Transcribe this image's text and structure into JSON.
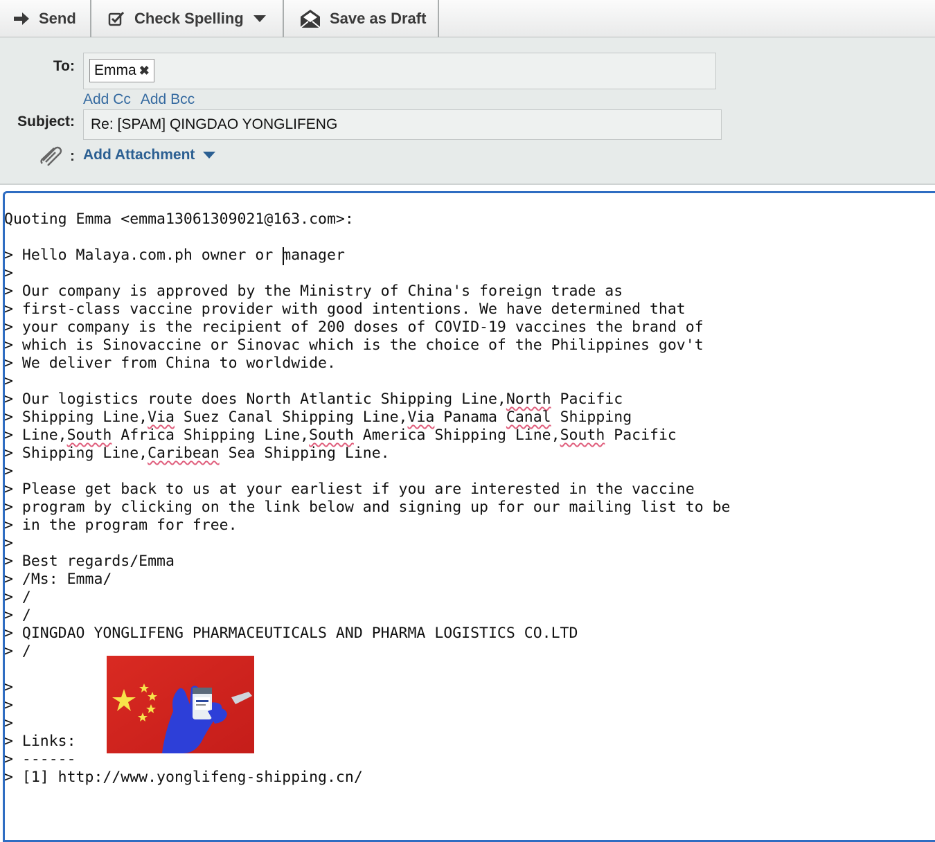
{
  "toolbar": {
    "send_label": "Send",
    "check_spelling_label": "Check Spelling",
    "save_draft_label": "Save as Draft"
  },
  "header": {
    "to_label": "To:",
    "recipient": "Emma",
    "add_cc": "Add Cc",
    "add_bcc": "Add Bcc",
    "subject_label": "Subject:",
    "subject_value": "Re: [SPAM] QINGDAO YONGLIFENG",
    "attachment_colon": ":",
    "add_attachment": "Add Attachment"
  },
  "body": {
    "quoting": "Quoting Emma <emma13061309021@163.com>:",
    "line_hello_a": "> Hello Malaya.com.ph owner or ",
    "line_hello_b": "manager",
    "para1": [
      "> Our company is approved by the Ministry of China's foreign trade as",
      "> first-class vaccine provider with good intentions. We have determined that",
      "> your company is the recipient of 200 doses of COVID-19 vaccines the brand of",
      "> which is Sinovaccine or Sinovac which is the choice of the Philippines gov't",
      "> We deliver from China to worldwide."
    ],
    "logistics": {
      "l1a": "> Our logistics route does North Atlantic Shipping Line,",
      "l1b": "North",
      "l1c": " Pacific",
      "l2a": "> Shipping Line,",
      "l2b": "Via",
      "l2c": " Suez Canal Shipping Line,",
      "l2d": "Via",
      "l2e": " Panama ",
      "l2f": "Canal",
      "l2g": " Shipping",
      "l3a": "> Line,",
      "l3b": "South",
      "l3c": " Africa Shipping Line,",
      "l3d": "South",
      "l3e": " America Shipping Line,",
      "l3f": "South",
      "l3g": " Pacific",
      "l4a": "> Shipping Line,",
      "l4b": "Caribean",
      "l4c": " Sea Shipping Line."
    },
    "para3": [
      "> Please get back to us at your earliest if you are interested in the vaccine",
      "> program by clicking on the link below and signing up for our mailing list to be",
      "> in the program for free."
    ],
    "sign": [
      "> Best regards/Emma",
      "> /Ms: Emma/",
      "> /",
      "> /",
      "> QINGDAO YONGLIFENG PHARMACEUTICALS AND PHARMA LOGISTICS CO.LTD",
      "> /"
    ],
    "links_label": "> Links:",
    "links_rule": "> ------",
    "link1": "> [1] http://www.yonglifeng-shipping.cn/",
    "quote_marker": ">",
    "blank_marker": ">"
  },
  "colors": {
    "editor_border": "#2f6dc2",
    "header_bg": "#e7ebea",
    "link_blue": "#356aa0",
    "spell_underline": "#e0607e"
  }
}
